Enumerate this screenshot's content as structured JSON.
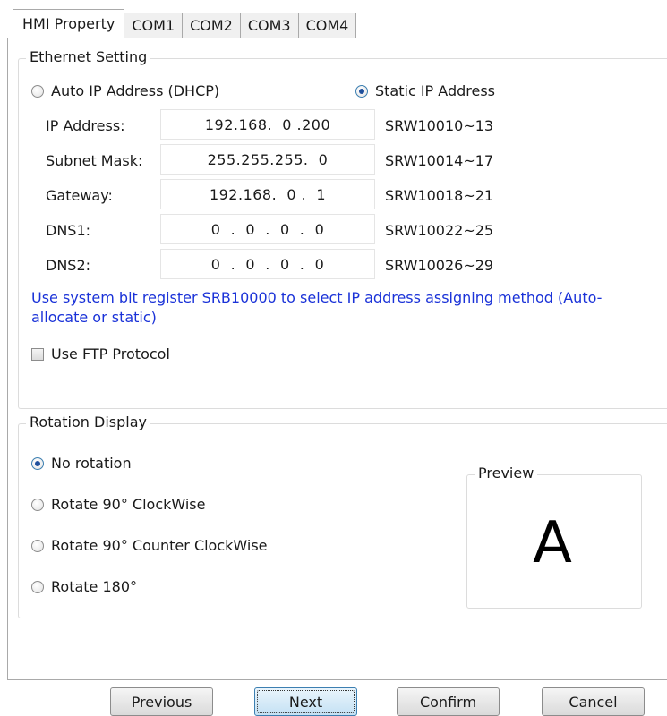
{
  "tabs": [
    {
      "label": "HMI Property",
      "active": true
    },
    {
      "label": "COM1",
      "active": false
    },
    {
      "label": "COM2",
      "active": false
    },
    {
      "label": "COM3",
      "active": false
    },
    {
      "label": "COM4",
      "active": false
    }
  ],
  "ethernet": {
    "title": "Ethernet Setting",
    "auto_ip_label": "Auto IP Address (DHCP)",
    "static_ip_label": "Static IP Address",
    "selected_mode": "static",
    "fields": [
      {
        "label": "IP Address:",
        "value": "192.168.  0 .200",
        "register": "SRW10010~13"
      },
      {
        "label": "Subnet Mask:",
        "value": "255.255.255.  0",
        "register": "SRW10014~17"
      },
      {
        "label": "Gateway:",
        "value": "192.168.  0 .  1",
        "register": "SRW10018~21"
      },
      {
        "label": "DNS1:",
        "value": "0  .  0  .  0  .  0",
        "register": "SRW10022~25"
      },
      {
        "label": "DNS2:",
        "value": "0  .  0  .  0  .  0",
        "register": "SRW10026~29"
      }
    ],
    "note": "Use system bit register SRB10000 to select IP address assigning method (Auto-allocate or static)",
    "ftp_label": "Use FTP Protocol",
    "ftp_checked": false
  },
  "rotation": {
    "title": "Rotation Display",
    "options": [
      {
        "label": "No rotation",
        "checked": true
      },
      {
        "label": "Rotate 90° ClockWise",
        "checked": false
      },
      {
        "label": "Rotate 90° Counter ClockWise",
        "checked": false
      },
      {
        "label": "Rotate 180°",
        "checked": false
      }
    ],
    "preview_title": "Preview",
    "preview_letter": "A"
  },
  "buttons": {
    "previous": "Previous",
    "next": "Next",
    "confirm": "Confirm",
    "cancel": "Cancel"
  },
  "colors": {
    "note_text": "#1a32d8",
    "radio_selected": "#1f4f9c"
  }
}
